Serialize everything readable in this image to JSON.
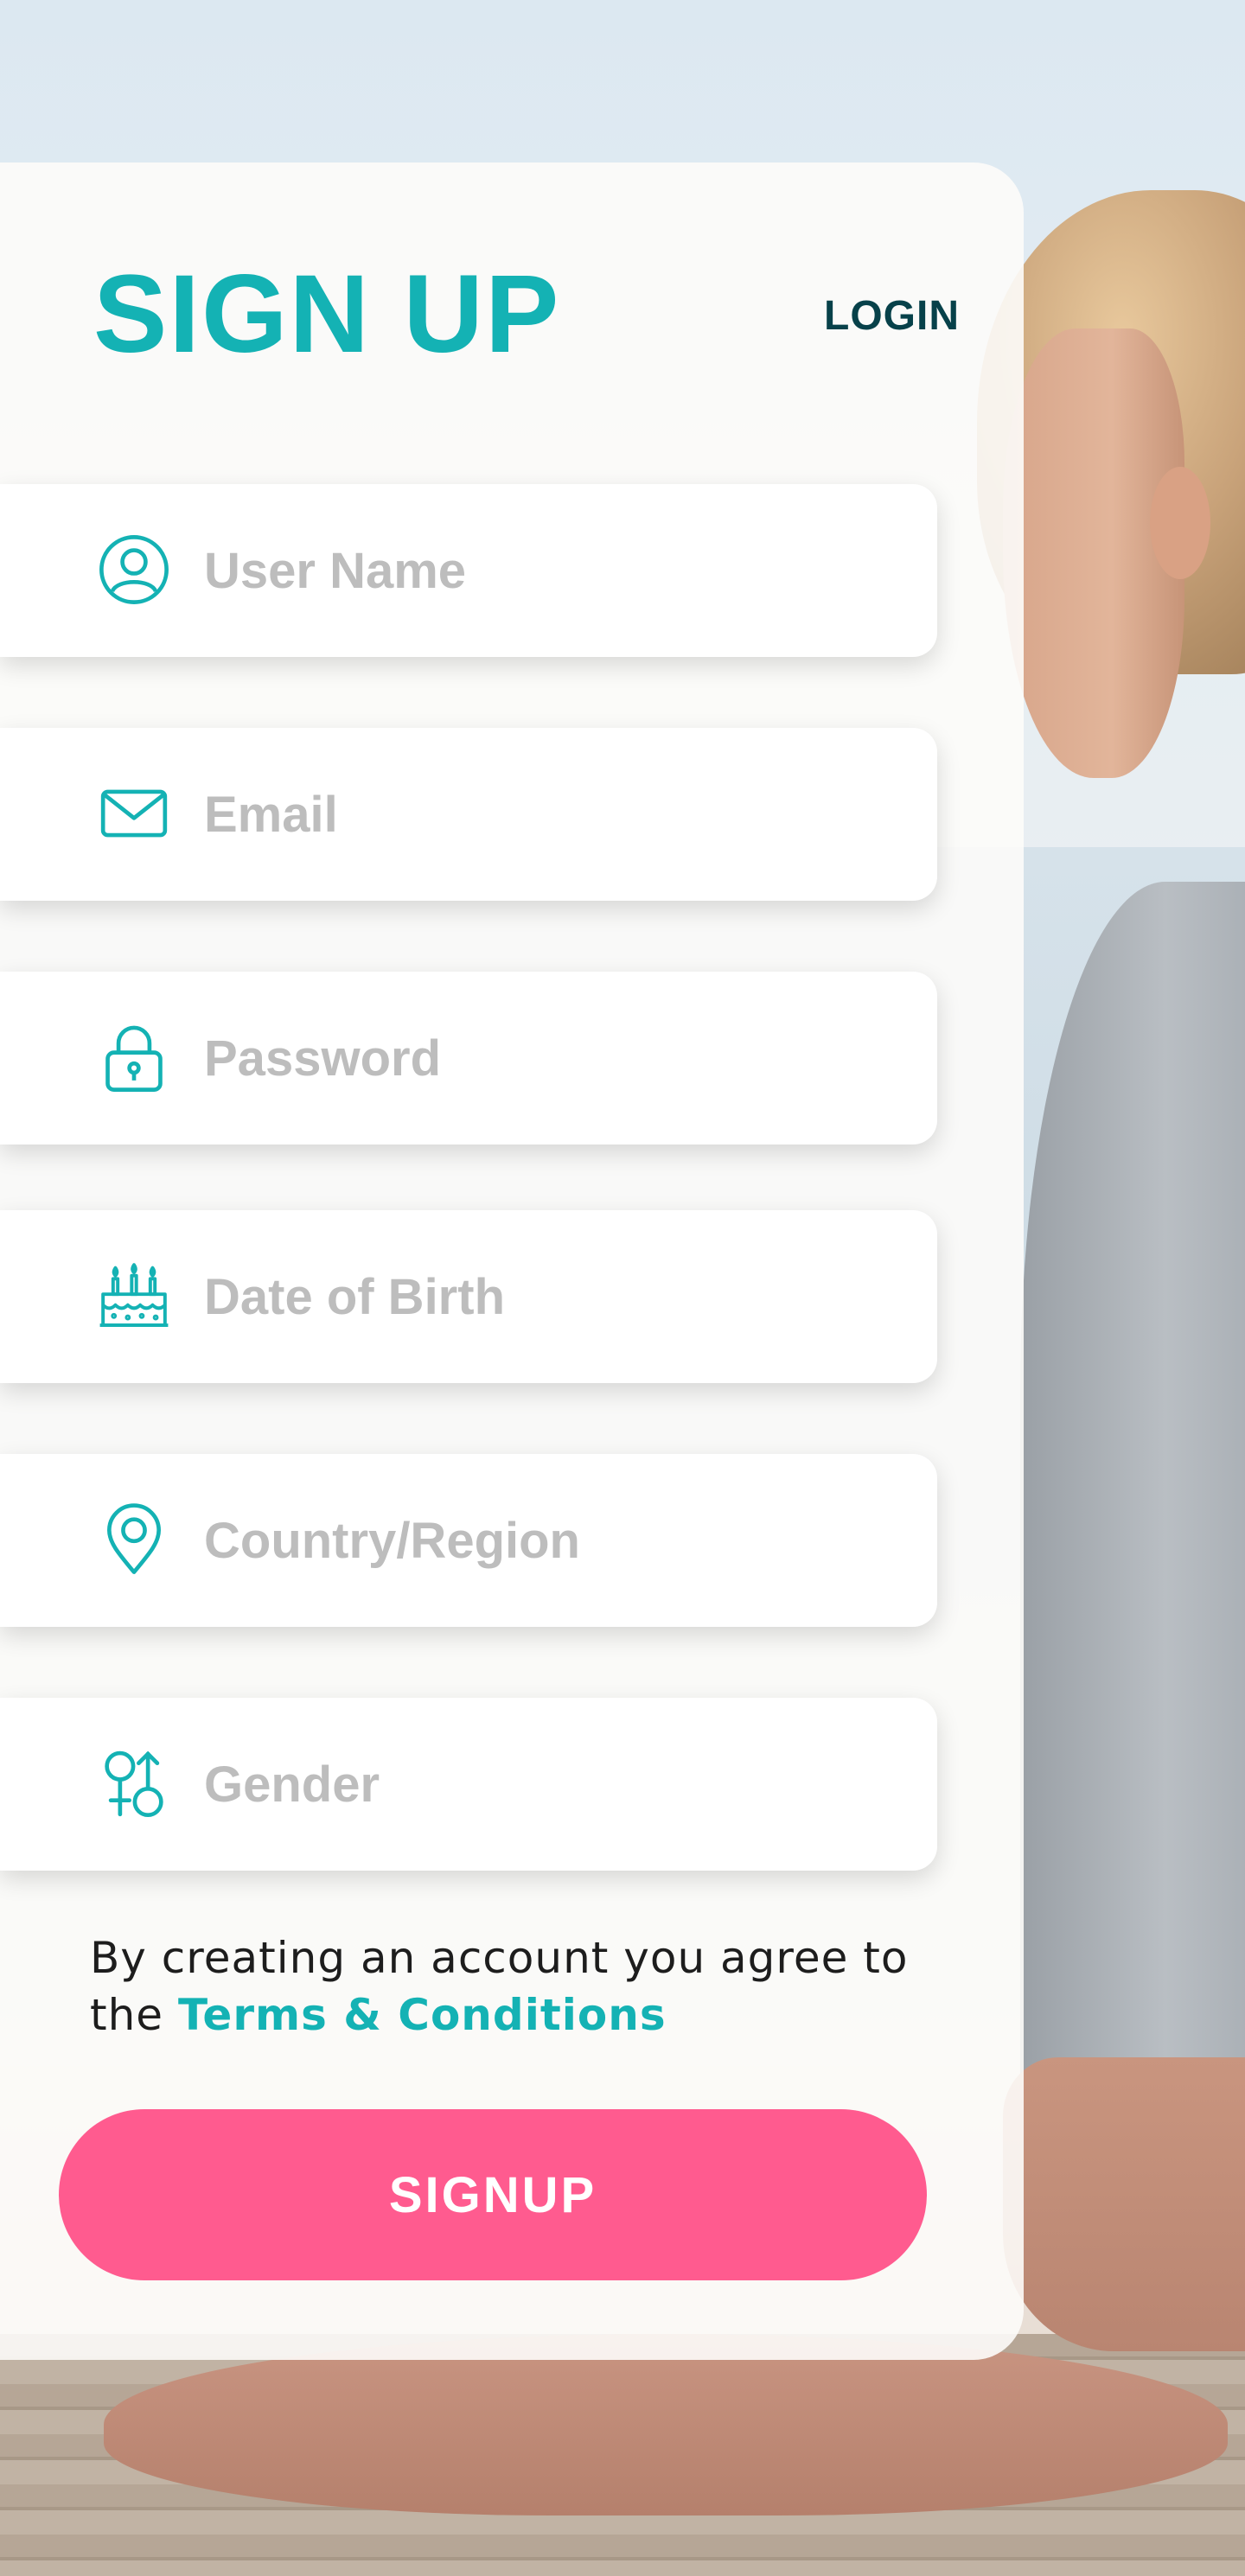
{
  "header": {
    "title": "SIGN UP",
    "login_label": "LOGIN"
  },
  "form": {
    "fields": [
      {
        "placeholder": "User Name",
        "value": "",
        "icon": "user-icon"
      },
      {
        "placeholder": "Email",
        "value": "",
        "icon": "mail-icon"
      },
      {
        "placeholder": "Password",
        "value": "",
        "icon": "lock-icon"
      },
      {
        "placeholder": "Date of Birth",
        "value": "",
        "icon": "cake-icon"
      },
      {
        "placeholder": "Country/Region",
        "value": "",
        "icon": "location-pin-icon"
      },
      {
        "placeholder": "Gender",
        "value": "",
        "icon": "gender-icon"
      }
    ],
    "terms_prefix": "By creating an account you agree to the ",
    "terms_link": "Terms & Conditions",
    "submit_label": "SIGNUP"
  },
  "colors": {
    "accent_teal": "#14b2b4",
    "login_dark": "#07414a",
    "button_pink": "#ff5b8f",
    "placeholder_gray": "#bdbdbd"
  }
}
